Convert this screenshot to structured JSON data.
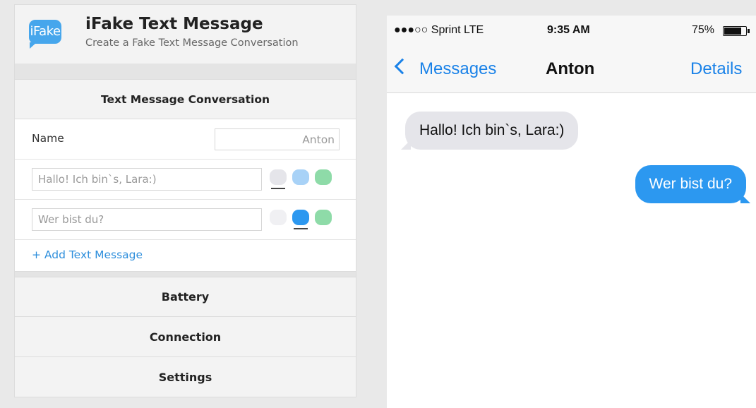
{
  "app": {
    "logo_text": "iFake",
    "title": "iFake Text Message",
    "subtitle": "Create a Fake Text Message Conversation"
  },
  "conversation": {
    "section_title": "Text Message Conversation",
    "name_label": "Name",
    "name_value": "Anton",
    "messages": [
      {
        "text": "Hallo! Ich bin`s, Lara:)",
        "selected_style": "gray"
      },
      {
        "text": "Wer bist du?",
        "selected_style": "blue"
      }
    ],
    "add_label": "+ Add Text Message"
  },
  "sections": {
    "battery": "Battery",
    "connection": "Connection",
    "settings": "Settings"
  },
  "colors": {
    "gray_bubble": "#e5e5ea",
    "blue_bubble": "#2c98f0",
    "green_bubble": "#8edba8",
    "light_blue_bubble": "#a8d2f7",
    "accent": "#1a82e8"
  },
  "phone": {
    "carrier": "●●●○○ Sprint  LTE",
    "time": "9:35 AM",
    "battery_percent": "75%",
    "battery_level": 0.75,
    "back_label": "Messages",
    "contact": "Anton",
    "details_label": "Details",
    "received": "Hallo! Ich bin`s, Lara:)",
    "sent": "Wer bist du?"
  }
}
